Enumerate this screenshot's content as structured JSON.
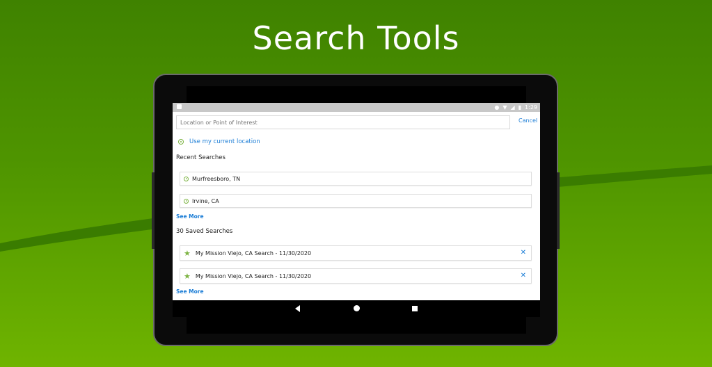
{
  "headline": "Search Tools",
  "statusbar": {
    "time": "1:29"
  },
  "search": {
    "placeholder": "Location or Point of Interest",
    "cancel_label": "Cancel"
  },
  "current_location": {
    "label": "Use my current location"
  },
  "recent": {
    "title": "Recent Searches",
    "items": [
      {
        "label": "Murfreesboro, TN"
      },
      {
        "label": "Irvine, CA"
      }
    ],
    "see_more": "See More"
  },
  "saved": {
    "title": "30 Saved Searches",
    "items": [
      {
        "label": "My Mission Viejo, CA Search - 11/30/2020"
      },
      {
        "label": "My Mission Viejo, CA Search - 11/30/2020"
      }
    ],
    "see_more": "See More"
  },
  "colors": {
    "accent_blue": "#1b7dd6",
    "accent_green": "#7cb342",
    "background_green": "#4f9500"
  },
  "icons": {
    "location": "crosshair-icon",
    "recent": "clock-icon",
    "saved": "star-icon",
    "remove": "close-icon",
    "nav_back": "back-triangle-icon",
    "nav_home": "home-circle-icon",
    "nav_recent": "recents-square-icon"
  }
}
